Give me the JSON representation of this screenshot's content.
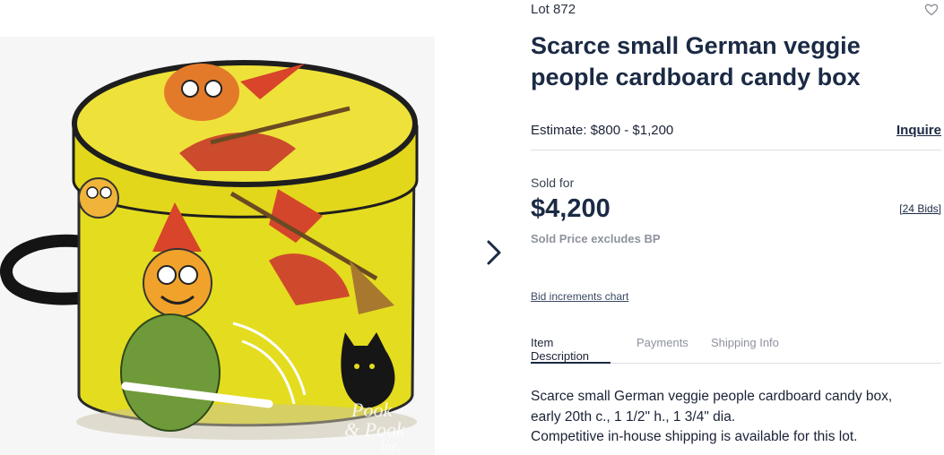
{
  "lot": {
    "label": "Lot 872"
  },
  "title": "Scarce small German veggie people cardboard candy box",
  "estimate": {
    "text": "Estimate: $800 - $1,200",
    "inquire": "Inquire"
  },
  "sold": {
    "label": "Sold for",
    "price": "$4,200",
    "bids": "[24 Bids]",
    "note": "Sold Price excludes BP"
  },
  "bid_increments": "Bid increments chart",
  "tabs": [
    {
      "label": "Item Description",
      "active": true
    },
    {
      "label": "Payments",
      "active": false
    },
    {
      "label": "Shipping Info",
      "active": false
    }
  ],
  "description": {
    "line1": "Scarce small German veggie people cardboard candy box,",
    "line2": "early 20th c., 1 1/2\" h., 1 3/4\" dia.",
    "line3": "Competitive in-house shipping is available for this lot."
  },
  "watermark": {
    "line1": "Pook",
    "line2": "& Pook",
    "line3": "Inc."
  },
  "colors": {
    "brand": "#1b2a44",
    "box_yellow": "#e7df1c",
    "muted": "#8d929c"
  },
  "icons": {
    "next": "chevron-right-icon",
    "favorite": "heart-icon"
  }
}
